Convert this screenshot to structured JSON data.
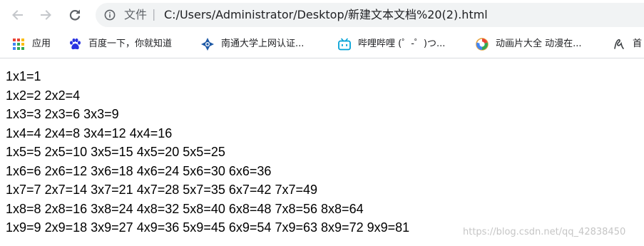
{
  "toolbar": {
    "back_icon": "arrow-left-icon",
    "forward_icon": "arrow-right-icon",
    "reload_icon": "reload-icon",
    "info_icon": "info-circle-icon",
    "scheme_label": "文件",
    "separator": "|",
    "url": "C:/Users/Administrator/Desktop/新建文本文档%20(2).html"
  },
  "bookmarks": [
    {
      "label": "应用",
      "icon": "apps-grid-icon"
    },
    {
      "label": "百度一下，你就知道",
      "icon": "baidu-paw-icon"
    },
    {
      "label": "南通大学上网认证...",
      "icon": "ntu-logo-icon"
    },
    {
      "label": "哔哩哔哩 (゜-゜)つ...",
      "icon": "bilibili-tv-icon"
    },
    {
      "label": "动画片大全 动漫在...",
      "icon": "donghua-logo-icon"
    },
    {
      "label": "首",
      "icon": "handwriting-logo-icon"
    }
  ],
  "multiplication_table": [
    [
      "1x1=1"
    ],
    [
      "1x2=2",
      "2x2=4"
    ],
    [
      "1x3=3",
      "2x3=6",
      "3x3=9"
    ],
    [
      "1x4=4",
      "2x4=8",
      "3x4=12",
      "4x4=16"
    ],
    [
      "1x5=5",
      "2x5=10",
      "3x5=15",
      "4x5=20",
      "5x5=25"
    ],
    [
      "1x6=6",
      "2x6=12",
      "3x6=18",
      "4x6=24",
      "5x6=30",
      "6x6=36"
    ],
    [
      "1x7=7",
      "2x7=14",
      "3x7=21",
      "4x7=28",
      "5x7=35",
      "6x7=42",
      "7x7=49"
    ],
    [
      "1x8=8",
      "2x8=16",
      "3x8=24",
      "4x8=32",
      "5x8=40",
      "6x8=48",
      "7x8=56",
      "8x8=64"
    ],
    [
      "1x9=9",
      "2x9=18",
      "3x9=27",
      "4x9=36",
      "5x9=45",
      "6x9=54",
      "7x9=63",
      "8x9=72",
      "9x9=81"
    ]
  ],
  "watermark": "https://blog.csdn.net/qq_42838450",
  "colors": {
    "toolbar_icon": "#5f6368",
    "omnibox_bg": "#f1f3f4",
    "text": "#000000",
    "ntu_blue": "#1f5aa6",
    "bilibili_blue": "#00a1d6",
    "baidu_blue": "#2932e1"
  }
}
